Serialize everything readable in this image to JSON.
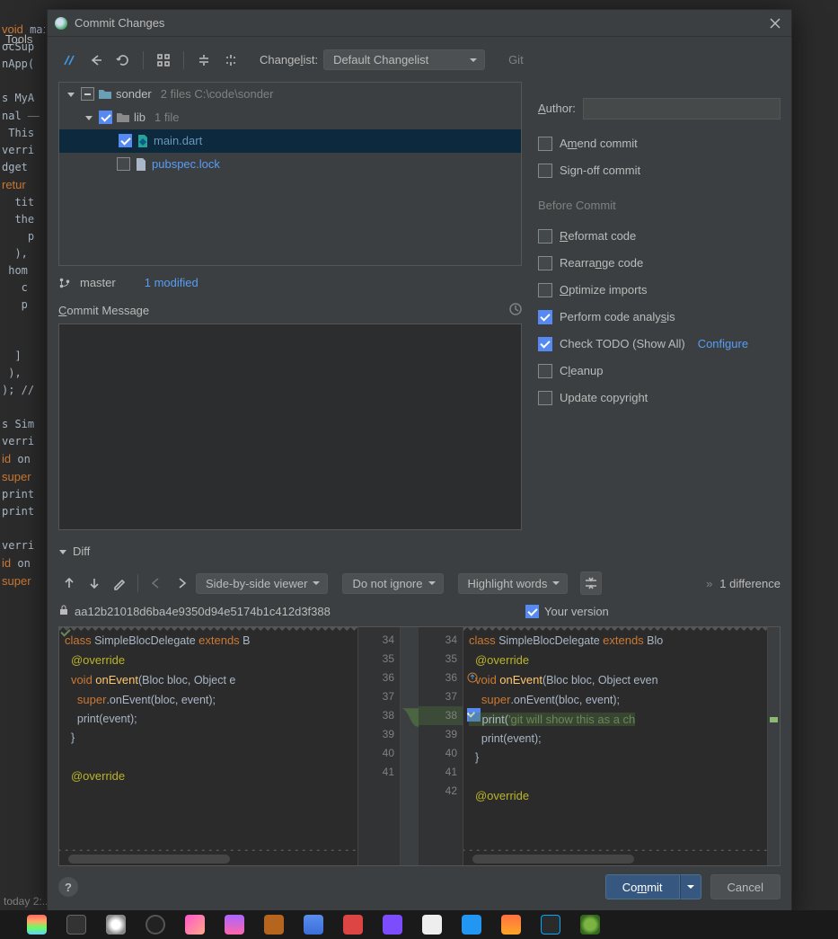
{
  "background": {
    "menu_tools": "Tools",
    "status": "today 2:..."
  },
  "dialog": {
    "title": "Commit Changes",
    "toolbar": {
      "changelist_label_html": "Changelist:",
      "changelist_value": "Default Changelist"
    },
    "git": {
      "header": "Git",
      "author_label": "Author:",
      "author_value": "",
      "amend": "Amend commit",
      "amend_checked": false,
      "signoff": "Sign-off commit",
      "signoff_checked": false
    },
    "before_commit": {
      "header": "Before Commit",
      "items": [
        {
          "label_u": "R",
          "label_rest": "eformat code",
          "checked": false
        },
        {
          "label_u": "",
          "label_rest": "Rearrange code",
          "checked": false,
          "u_pos": "Rearra",
          "u_char": "n",
          "tail": "ge code"
        },
        {
          "label_u": "O",
          "label_rest": "ptimize imports",
          "checked": false
        },
        {
          "label_u": "",
          "label_rest": "Perform code analysis",
          "checked": true,
          "plain_pre": "Perform code analy",
          "u_char": "s",
          "tail": "is"
        },
        {
          "label_u": "",
          "label_rest": "Check TODO (Show All)",
          "checked": true,
          "link": "Configure"
        },
        {
          "label_u": "C",
          "label_rest": "leanup",
          "checked": false
        },
        {
          "label_u": "",
          "label_rest": "Update copyright",
          "checked": false
        }
      ]
    },
    "tree": {
      "root": {
        "name": "sonder",
        "hint": "2 files  C:\\code\\sonder"
      },
      "lib": {
        "name": "lib",
        "hint": "1 file"
      },
      "main": {
        "name": "main.dart"
      },
      "pubspec": {
        "name": "pubspec.lock"
      },
      "branch": "master",
      "modified": "1 modified"
    },
    "commit_message": {
      "label": "Commit Message",
      "value": ""
    },
    "diff": {
      "label": "Diff",
      "viewer": "Side-by-side viewer",
      "ws": "Do not ignore",
      "hl": "Highlight words",
      "count": "1 difference",
      "left_hash": "aa12b21018d6ba4e9350d94e5174b1c412d3f388",
      "right_label": "Your version",
      "left_lines": [
        "34",
        "35",
        "36",
        "37",
        "38",
        "39",
        "40",
        "41"
      ],
      "right_lines": [
        "34",
        "35",
        "36",
        "37",
        "38",
        "39",
        "40",
        "41",
        "42"
      ]
    },
    "buttons": {
      "commit": "Commit",
      "cancel": "Cancel"
    }
  }
}
